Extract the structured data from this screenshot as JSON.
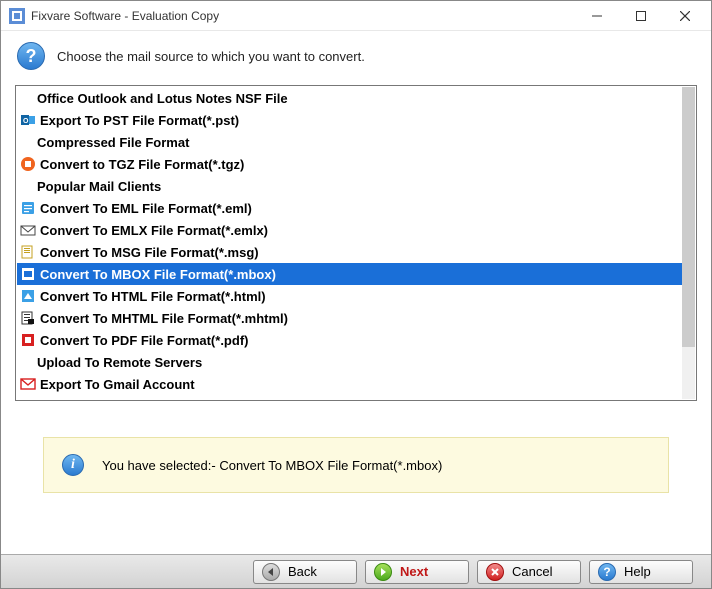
{
  "window": {
    "title": "Fixvare Software - Evaluation Copy"
  },
  "header": {
    "instruction": "Choose the mail source to which you want to convert."
  },
  "list": {
    "selectedIndex": 8,
    "items": [
      {
        "label": "Office Outlook and Lotus Notes NSF File",
        "header": true,
        "icon": "none"
      },
      {
        "label": "Export To PST File Format(*.pst)",
        "header": false,
        "icon": "outlook"
      },
      {
        "label": "Compressed File Format",
        "header": true,
        "icon": "none"
      },
      {
        "label": "Convert to TGZ File Format(*.tgz)",
        "header": false,
        "icon": "tgz"
      },
      {
        "label": "Popular Mail Clients",
        "header": true,
        "icon": "none"
      },
      {
        "label": "Convert To EML File Format(*.eml)",
        "header": false,
        "icon": "eml"
      },
      {
        "label": "Convert To EMLX File Format(*.emlx)",
        "header": false,
        "icon": "emlx"
      },
      {
        "label": "Convert To MSG File Format(*.msg)",
        "header": false,
        "icon": "msg"
      },
      {
        "label": "Convert To MBOX File Format(*.mbox)",
        "header": false,
        "icon": "mbox"
      },
      {
        "label": "Convert To HTML File Format(*.html)",
        "header": false,
        "icon": "html"
      },
      {
        "label": "Convert To MHTML File Format(*.mhtml)",
        "header": false,
        "icon": "mhtml"
      },
      {
        "label": "Convert To PDF File Format(*.pdf)",
        "header": false,
        "icon": "pdf"
      },
      {
        "label": "Upload To Remote Servers",
        "header": true,
        "icon": "none"
      },
      {
        "label": "Export To Gmail Account",
        "header": false,
        "icon": "gmail"
      }
    ]
  },
  "info": {
    "text": "You have selected:- Convert To MBOX File Format(*.mbox)"
  },
  "buttons": {
    "back": "Back",
    "next": "Next",
    "cancel": "Cancel",
    "help": "Help"
  }
}
